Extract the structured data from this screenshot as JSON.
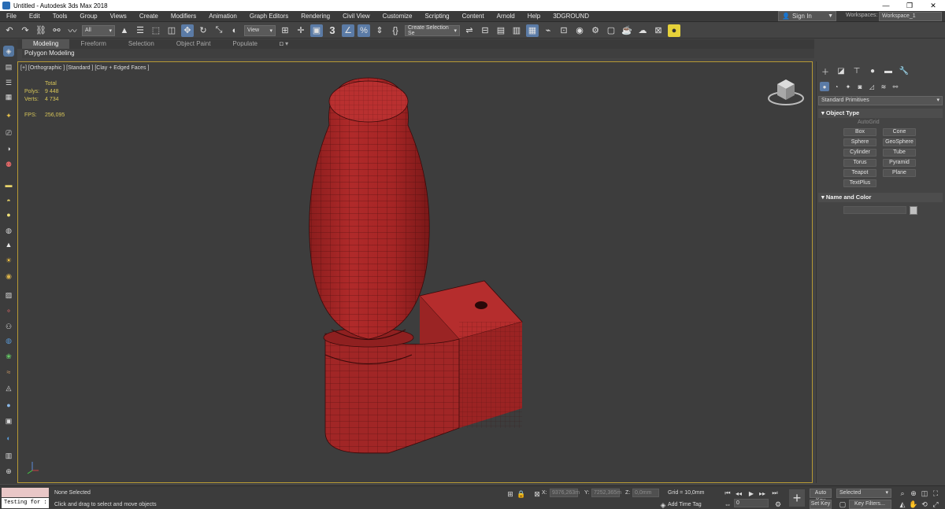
{
  "window": {
    "title": "Untitled - Autodesk 3ds Max 2018",
    "minimize": "—",
    "restore": "❐",
    "close": "✕"
  },
  "menu": {
    "items": [
      "File",
      "Edit",
      "Tools",
      "Group",
      "Views",
      "Create",
      "Modifiers",
      "Animation",
      "Graph Editors",
      "Rendering",
      "Civil View",
      "Customize",
      "Scripting",
      "Content",
      "Arnold",
      "Help",
      "3DGROUND"
    ],
    "signin": "Sign In",
    "workspaces_label": "Workspaces:",
    "workspace": "Workspace_1"
  },
  "toolbar": {
    "selection_filter": "All",
    "ref_coord": "View",
    "snap_3": "3",
    "named_selection": "Create Selection Se"
  },
  "ribbon": {
    "tabs": [
      "Modeling",
      "Freeform",
      "Selection",
      "Object Paint",
      "Populate"
    ],
    "subtitle": "Polygon Modeling"
  },
  "viewport": {
    "label": "[+] [Orthographic ] [Standard ] [Clay + Edged Faces ]",
    "stats_header": "Total",
    "polys_label": "Polys:",
    "polys_value": "9 448",
    "verts_label": "Verts:",
    "verts_value": "4 734",
    "fps_label": "FPS:",
    "fps_value": "256,095",
    "mesh_color": "#a82424"
  },
  "command_panel": {
    "dropdown": "Standard Primitives",
    "object_type_title": "Object Type",
    "autogrid": "AutoGrid",
    "buttons": [
      "Box",
      "Cone",
      "Sphere",
      "GeoSphere",
      "Cylinder",
      "Tube",
      "Torus",
      "Pyramid",
      "Teapot",
      "Plane",
      "TextPlus"
    ],
    "name_color_title": "Name and Color"
  },
  "status": {
    "maxscript_text": "Testing for :",
    "selection": "None Selected",
    "hint": "Click and drag to select and move objects",
    "x_label": "X:",
    "x_value": "9376,263m",
    "y_label": "Y:",
    "y_value": "7252,365m",
    "z_label": "Z:",
    "z_value": "0,0mm",
    "grid": "Grid = 10,0mm",
    "add_time_tag": "Add Time Tag",
    "frame": "0",
    "auto_key": "Auto Key",
    "set_key": "Set Key",
    "key_mode": "Selected",
    "key_filters": "Key Filters..."
  }
}
